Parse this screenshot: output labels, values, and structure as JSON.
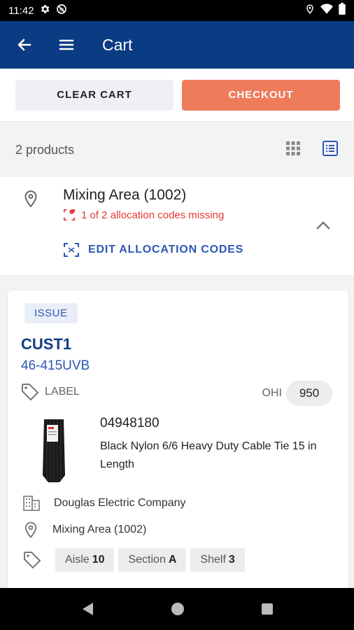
{
  "status_bar": {
    "time": "11:42"
  },
  "app_bar": {
    "title": "Cart"
  },
  "actions": {
    "clear_label": "CLEAR CART",
    "checkout_label": "CHECKOUT"
  },
  "summary": {
    "count_text": "2  products"
  },
  "location": {
    "title": "Mixing Area (1002)",
    "warning": "1 of 2 allocation codes missing",
    "edit_label": "EDIT ALLOCATION CODES"
  },
  "product": {
    "badge": "ISSUE",
    "customer": "CUST1",
    "code": "46-415UVB",
    "label_text": "LABEL",
    "ohi_label": "OHI",
    "ohi_value": "950",
    "sku": "04948180",
    "description": "Black Nylon 6/6 Heavy Duty Cable Tie 15 in Length",
    "supplier": "Douglas Electric Company",
    "location": "Mixing Area (1002)",
    "tags": [
      {
        "label": "Aisle",
        "value": "10"
      },
      {
        "label": "Section",
        "value": "A"
      },
      {
        "label": "Shelf",
        "value": "3"
      }
    ]
  },
  "colors": {
    "primary": "#0b3b82",
    "accent": "#ee7b5a",
    "link": "#2b58b3",
    "warning": "#e53935"
  },
  "icons": [
    "settings-icon",
    "block-icon",
    "location-icon",
    "wifi-icon",
    "battery-icon",
    "back-arrow-icon",
    "menu-icon",
    "grid-view-icon",
    "list-view-icon",
    "pin-icon",
    "scan-warning-icon",
    "chevron-up-icon",
    "scan-icon",
    "tag-icon",
    "building-icon",
    "nav-back-icon",
    "nav-home-icon",
    "nav-recents-icon"
  ]
}
